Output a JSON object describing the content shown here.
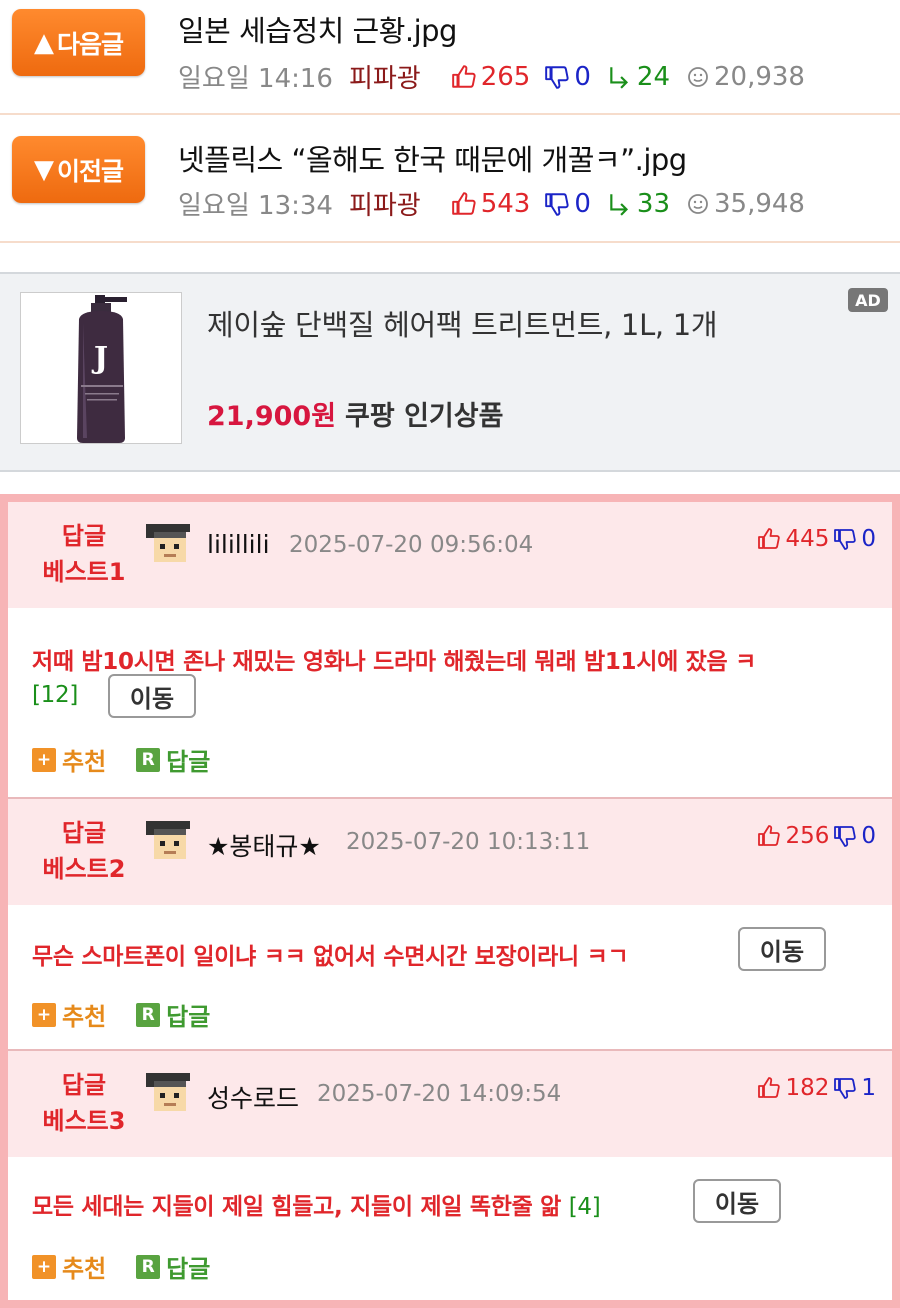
{
  "nav": {
    "next": {
      "button_label": "다음글",
      "title": "일본 세습정치 근황.jpg",
      "day": "일요일 14:16",
      "author": "피파광",
      "up": "265",
      "down": "0",
      "share": "24",
      "views": "20,938"
    },
    "prev": {
      "button_label": "이전글",
      "title": "넷플릭스 “올해도 한국 때문에 개꿀ㅋ”.jpg",
      "day": "일요일 13:34",
      "author": "피파광",
      "up": "543",
      "down": "0",
      "share": "33",
      "views": "35,948"
    }
  },
  "ad": {
    "badge": "AD",
    "title": "제이숲 단백질 헤어팩 트리트먼트, 1L, 1개",
    "price": "21,900원",
    "tag": "쿠팡 인기상품",
    "product_letter": "J"
  },
  "best": [
    {
      "label_line1": "답글",
      "label_line2": "베스트1",
      "nick": "lilillili",
      "date": "2025-07-20 09:56:04",
      "up": "445",
      "down": "0",
      "body": "저때 밤10시면 존나 재밌는 영화나 드라마 해줬는데 뭐래 밤11시에 잤음 ㅋ",
      "reply_count": "[12]",
      "move_label": "이동",
      "recommend_label": "추천",
      "reply_label": "답글"
    },
    {
      "label_line1": "답글",
      "label_line2": "베스트2",
      "nick": "★봉태규★",
      "date": "2025-07-20 10:13:11",
      "up": "256",
      "down": "0",
      "body": "무슨 스마트폰이 일이냐 ㅋㅋ 없어서 수면시간 보장이라니 ㅋㄱ",
      "move_label": "이동",
      "recommend_label": "추천",
      "reply_label": "답글"
    },
    {
      "label_line1": "답글",
      "label_line2": "베스트3",
      "nick": "성수로드",
      "date": "2025-07-20 14:09:54",
      "up": "182",
      "down": "1",
      "body": "모든 세대는 지들이 제일 힘들고, 지들이 제일 똑한줄 앎",
      "reply_count": "[4]",
      "move_label": "이동",
      "recommend_label": "추천",
      "reply_label": "답글"
    }
  ],
  "icons": {
    "up": "thumb-up-icon",
    "down": "thumb-down-icon",
    "share": "share-arrow-icon",
    "views": "smile-view-icon",
    "plus": "plus-square-icon",
    "reply": "reply-r-icon"
  },
  "colors": {
    "nav_button": "#ee6a0f",
    "best_border": "#f7b4b6",
    "best_header_bg": "#fde8ea",
    "best_text": "#e0262b",
    "price": "#d7163f"
  }
}
